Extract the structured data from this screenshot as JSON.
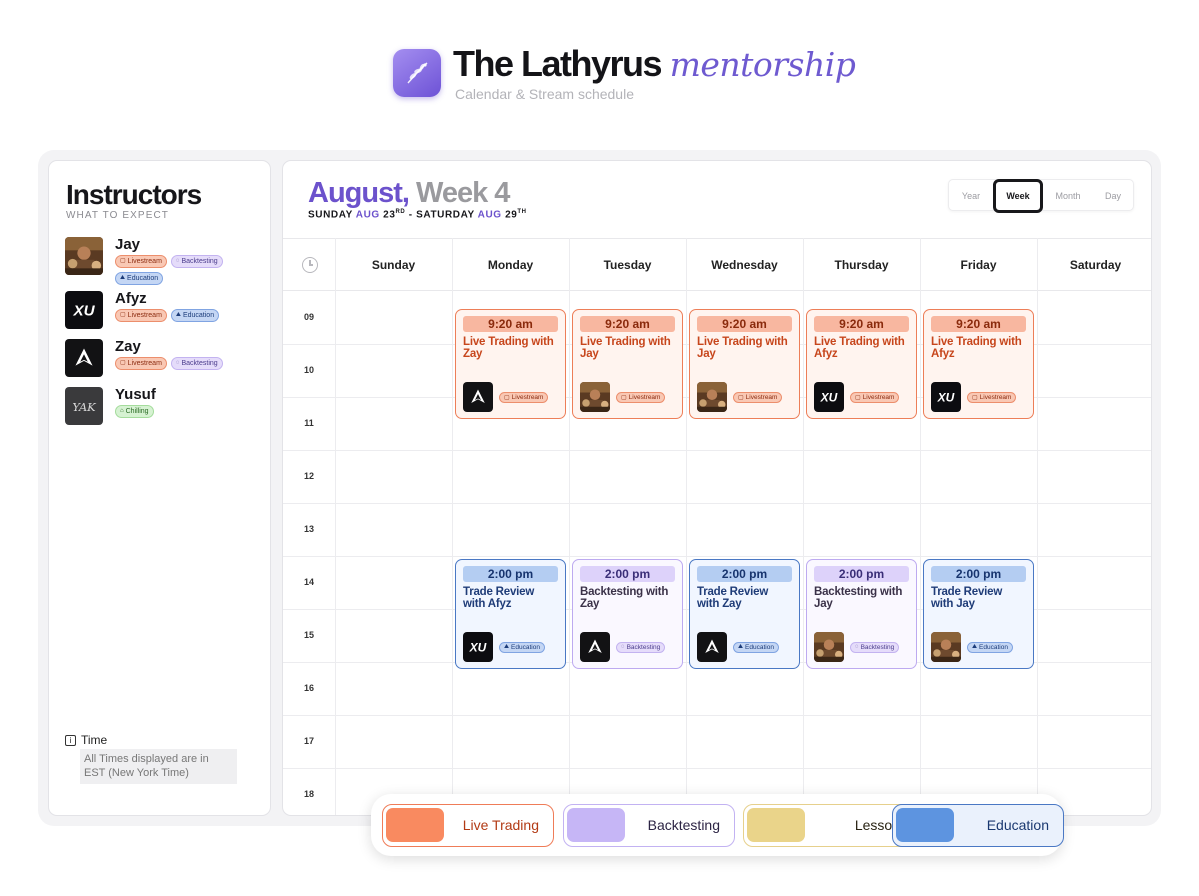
{
  "brand": {
    "title": "The Lathyrus",
    "title_script": "mentorship",
    "subtitle": "Calendar & Stream schedule",
    "icon": "leaf-sprig-icon"
  },
  "instructors_panel": {
    "title": "Instructors",
    "subtitle": "WHAT TO EXPECT",
    "instructors": [
      {
        "name": "Jay",
        "avatar": "photo-avatar",
        "tags": [
          {
            "label": "Livestream",
            "type": "live"
          },
          {
            "label": "Backtesting",
            "type": "back"
          },
          {
            "label": "Education",
            "type": "edu"
          }
        ]
      },
      {
        "name": "Afyz",
        "avatar": "xu-logo-avatar",
        "tags": [
          {
            "label": "Livestream",
            "type": "live"
          },
          {
            "label": "Education",
            "type": "edu"
          }
        ]
      },
      {
        "name": "Zay",
        "avatar": "peak-logo-avatar",
        "tags": [
          {
            "label": "Livestream",
            "type": "live"
          },
          {
            "label": "Backtesting",
            "type": "back"
          }
        ]
      },
      {
        "name": "Yusuf",
        "avatar": "signature-avatar",
        "avatar_text": "YAK",
        "tags": [
          {
            "label": "Chilling",
            "type": "chill"
          }
        ]
      }
    ],
    "time_label": "Time",
    "time_note": "All Times displayed are in EST (New York Time)"
  },
  "calendar": {
    "month": "August,",
    "week": "Week 4",
    "range": {
      "start_day": "SUNDAY",
      "start_month": "AUG",
      "start_date": "23",
      "start_suffix": "RD",
      "separator": "-",
      "end_day": "SATURDAY",
      "end_month": "AUG",
      "end_date": "29",
      "end_suffix": "TH"
    },
    "views": [
      "Year",
      "Week",
      "Month",
      "Day"
    ],
    "active_view": "Week",
    "days": [
      "Sunday",
      "Monday",
      "Tuesday",
      "Wednesday",
      "Thursday",
      "Friday",
      "Saturday"
    ],
    "hours": [
      "09",
      "10",
      "11",
      "12",
      "13",
      "14",
      "15",
      "16",
      "17",
      "18"
    ],
    "events": [
      {
        "day": "Monday",
        "time": "9:20 am",
        "title": "Live Trading with Zay",
        "type": "live",
        "avatar": "zay",
        "tag": "Livestream"
      },
      {
        "day": "Tuesday",
        "time": "9:20 am",
        "title": "Live Trading with Jay",
        "type": "live",
        "avatar": "jay",
        "tag": "Livestream"
      },
      {
        "day": "Wednesday",
        "time": "9:20 am",
        "title": "Live Trading with Jay",
        "type": "live",
        "avatar": "jay",
        "tag": "Livestream"
      },
      {
        "day": "Thursday",
        "time": "9:20 am",
        "title": "Live Trading with Afyz",
        "type": "live",
        "avatar": "afyz",
        "tag": "Livestream"
      },
      {
        "day": "Friday",
        "time": "9:20 am",
        "title": "Live Trading with Afyz",
        "type": "live",
        "avatar": "afyz",
        "tag": "Livestream"
      },
      {
        "day": "Monday",
        "time": "2:00 pm",
        "title": "Trade Review with Afyz",
        "type": "edu",
        "avatar": "afyz",
        "tag": "Education"
      },
      {
        "day": "Tuesday",
        "time": "2:00 pm",
        "title": "Backtesting with Zay",
        "type": "back",
        "avatar": "zay",
        "tag": "Backtesting"
      },
      {
        "day": "Wednesday",
        "time": "2:00 pm",
        "title": "Trade Review with Zay",
        "type": "edu",
        "avatar": "zay",
        "tag": "Education"
      },
      {
        "day": "Thursday",
        "time": "2:00 pm",
        "title": "Backtesting with Jay",
        "type": "back",
        "avatar": "jay",
        "tag": "Backtesting"
      },
      {
        "day": "Friday",
        "time": "2:00 pm",
        "title": "Trade Review with Jay",
        "type": "edu",
        "avatar": "jay",
        "tag": "Education"
      }
    ]
  },
  "legend": [
    {
      "label": "Live Trading",
      "color": "#f98a60",
      "border": "#ef7c58",
      "text": "#b23a14"
    },
    {
      "label": "Backtesting",
      "color": "#c6b6f6",
      "border": "#c2b2f2",
      "text": "#2c2444"
    },
    {
      "label": "Lesson",
      "color": "#ead48a",
      "border": "#e6d08c",
      "text": "#2a2414"
    },
    {
      "label": "Education",
      "color": "#5d94e0",
      "border": "#4a78c4",
      "text": "#1a3870"
    }
  ],
  "colors": {
    "accent_purple": "#6c52cc",
    "live": "#ed7e58",
    "backtesting": "#bdaaf0",
    "education": "#4a78c4",
    "lesson": "#e6d08c"
  }
}
